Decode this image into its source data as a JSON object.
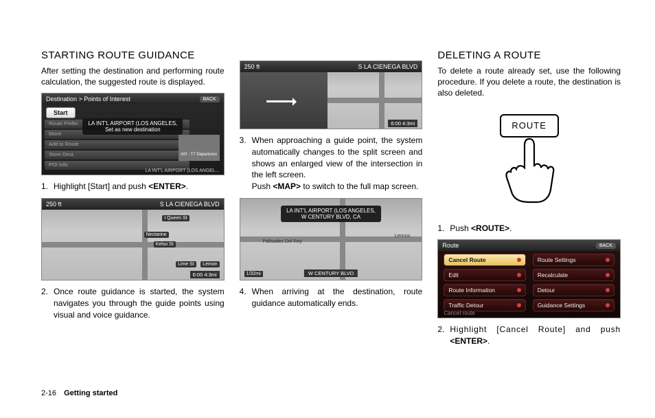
{
  "col1": {
    "heading": "STARTING ROUTE GUIDANCE",
    "intro": "After setting the destination and performing route calculation, the suggested route is displayed.",
    "screenshot1": {
      "breadcrumb": "Destination > Points of Interest",
      "back": "BACK",
      "start": "Start",
      "rows": [
        "Route Prefer.",
        "Move",
        "Add to Route",
        "Store Dest.",
        "POI Info."
      ],
      "popup_line1": "LA INT'L AIRPORT (LOS ANGELES,",
      "popup_line2": "Set as new destination",
      "thumb_caption": "Int'l - T7 Departures",
      "footer": "LA INT'L AIRPORT (LOS ANGEL..."
    },
    "step1_num": "1.",
    "step1_text_a": "Highlight [Start] and push ",
    "step1_text_b": "<ENTER>",
    "step1_text_c": ".",
    "screenshot2": {
      "dist": "250 ft",
      "road": "S LA CIENEGA BLVD",
      "streets": [
        "I Queen St",
        "Nectarine",
        "Kelso St",
        "Lime St",
        "Lemon"
      ],
      "time": "6:00  4:3mi"
    },
    "step2_num": "2.",
    "step2_text": "Once route guidance is started, the system navigates you through the guide points using visual and voice guidance."
  },
  "col2": {
    "screenshot3": {
      "dist": "250 ft",
      "road": "S LA CIENEGA BLVD",
      "time": "6:00  4:3mi"
    },
    "step3_num": "3.",
    "step3_text_a": "When approaching a guide point, the system automatically changes to the split screen and shows an enlarged view of the intersection in the left screen.",
    "step3_text_b": "Push ",
    "step3_text_c": "<MAP>",
    "step3_text_d": " to switch to the full map screen.",
    "screenshot4": {
      "popup_line1": "LA INT'L AIRPORT (LOS ANGELES,",
      "popup_line2": "W CENTURY BLVD, CA",
      "labels": [
        "Palisades Del Rey",
        "Lennox"
      ],
      "bottom_road": "W CENTURY BLVD",
      "scale": "1/32mi"
    },
    "step4_num": "4.",
    "step4_text": "When arriving at the destination, route guidance automatically ends."
  },
  "col3": {
    "heading": "DELETING A ROUTE",
    "intro": "To delete a route already set, use the following procedure. If you delete a route, the destination is also deleted.",
    "button_label": "ROUTE",
    "step1_num": "1.",
    "step1_text_a": "Push ",
    "step1_text_b": "<ROUTE>",
    "step1_text_c": ".",
    "screenshot5": {
      "title": "Route",
      "back": "BACK",
      "left": [
        "Cancel Route",
        "Edit",
        "Route Information",
        "Traffic Detour"
      ],
      "right": [
        "Route Settings",
        "Recalculate",
        "Detour",
        "Guidance Settings"
      ],
      "footer": "Cancel route"
    },
    "step2_num": "2.",
    "step2_text_a": "Highlight [Cancel Route] and push ",
    "step2_text_b": "<ENTER>",
    "step2_text_c": "."
  },
  "footer": {
    "page": "2-16",
    "section": "Getting started"
  }
}
